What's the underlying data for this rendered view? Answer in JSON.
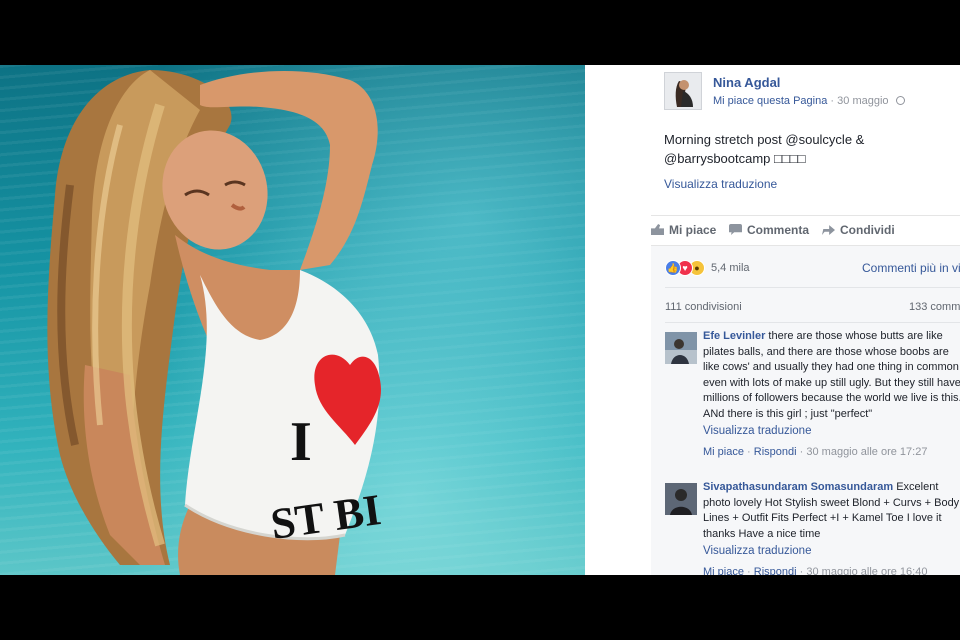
{
  "post": {
    "author": "Nina Agdal",
    "like_page": "Mi piace questa Pagina",
    "date": "30 maggio",
    "text": "Morning stretch post @soulcycle & @barrysbootcamp □□□□",
    "translate": "Visualizza traduzione"
  },
  "actions": {
    "like": "Mi piace",
    "comment": "Commenta",
    "share": "Condividi"
  },
  "reactions": {
    "count": "5,4 mila",
    "comments_in_view": "Commenti più in vi",
    "shares": "111 condivisioni",
    "comment_count": "133 comm"
  },
  "comments": [
    {
      "name": "Efe Levinler",
      "text": "there are those whose butts are like pilates balls, and there are those whose boobs are like cows' and usually they had one thing in common ; even with lots of make up still ugly. But they still have millions of followers because the world we live is this. ANd there is this girl ; just \"perfect\"",
      "translate": "Visualizza traduzione",
      "like": "Mi piace",
      "reply": "Rispondi",
      "time": "30 maggio alle ore 17:27"
    },
    {
      "name": "Sivapathasundaram Somasundaram",
      "text": "Excelent photo lovely Hot Stylish sweet Blond + Curvs + Body Lines + Outfit Fits Perfect +I + Kamel Toe I love it thanks Have a nice time",
      "translate": "Visualizza traduzione",
      "like": "Mi piace",
      "reply": "Rispondi",
      "time": "30 maggio alle ore 16:40"
    }
  ],
  "photo": {
    "shirt_text_1": "I",
    "shirt_text_2": "ST BI"
  },
  "colors": {
    "link": "#365899",
    "sea": "#1694a4",
    "heart": "#e5252a"
  }
}
